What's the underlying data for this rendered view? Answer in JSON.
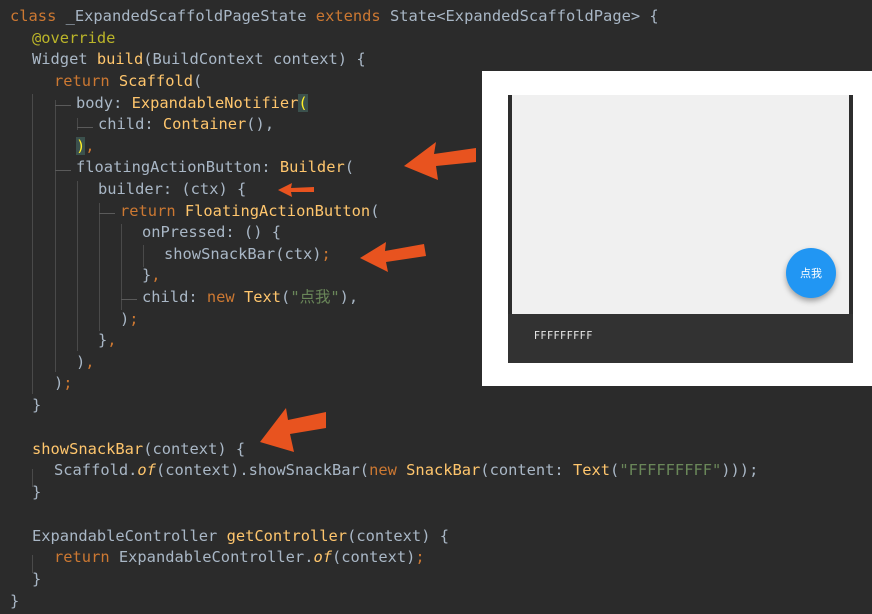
{
  "code": {
    "l1": {
      "a": "class ",
      "b": "_ExpandedScaffoldPageState ",
      "c": "extends ",
      "d": "State<ExpandedScaffoldPage> {"
    },
    "l2": {
      "a": "@override"
    },
    "l3": {
      "a": "Widget ",
      "b": "build",
      "c": "(BuildContext context) {"
    },
    "l4": {
      "a": "return ",
      "b": "Scaffold",
      "c": "("
    },
    "l5": {
      "a": "body: ",
      "b": "ExpandableNotifier",
      "c": "("
    },
    "l6": {
      "a": "child: ",
      "b": "Container",
      "c": "(),"
    },
    "l7": {
      "a": ")",
      "b": ","
    },
    "l8": {
      "a": "floatingActionButton: ",
      "b": "Builder",
      "c": "("
    },
    "l9": {
      "a": "builder: (ctx) {"
    },
    "l10": {
      "a": "return ",
      "b": "FloatingActionButton",
      "c": "("
    },
    "l11": {
      "a": "onPressed: () {"
    },
    "l12": {
      "a": "showSnackBar(ctx)",
      "b": ";"
    },
    "l13": {
      "a": "}",
      "b": ","
    },
    "l14": {
      "a": "child: ",
      "b": "new ",
      "c": "Text",
      "d": "(",
      "e": "\"点我\"",
      "f": "),"
    },
    "l15": {
      "a": ")",
      "b": ";"
    },
    "l16": {
      "a": "}",
      "b": ","
    },
    "l17": {
      "a": ")",
      "b": ","
    },
    "l18": {
      "a": ")",
      "b": ";"
    },
    "l19": {
      "a": "}"
    },
    "l21": {
      "a": "showSnackBar",
      "b": "(context) {"
    },
    "l22": {
      "a": "Scaffold.",
      "b": "of",
      "c": "(context).showSnackBar(",
      "d": "new ",
      "e": "SnackBar",
      "f": "(content: ",
      "g": "Text",
      "h": "(",
      "i": "\"FFFFFFFFF\"",
      "j": ")));"
    },
    "l23": {
      "a": "}"
    },
    "l25": {
      "a": "ExpandableController ",
      "b": "getController",
      "c": "(context) {"
    },
    "l26": {
      "a": "return ",
      "b": "ExpandableController.",
      "c": "of",
      "d": "(context)",
      "e": ";"
    },
    "l27": {
      "a": "}"
    },
    "l28": {
      "a": "}"
    }
  },
  "preview": {
    "fab_label": "点我",
    "snackbar_text": "FFFFFFFFF"
  },
  "colors": {
    "background": "#2b2b2b",
    "keyword": "#cc7832",
    "function": "#ffc66d",
    "annotation": "#bbb529",
    "string": "#6a8759",
    "arrow": "#e8531f",
    "fab": "#2196f3",
    "snackbar": "#323232"
  }
}
